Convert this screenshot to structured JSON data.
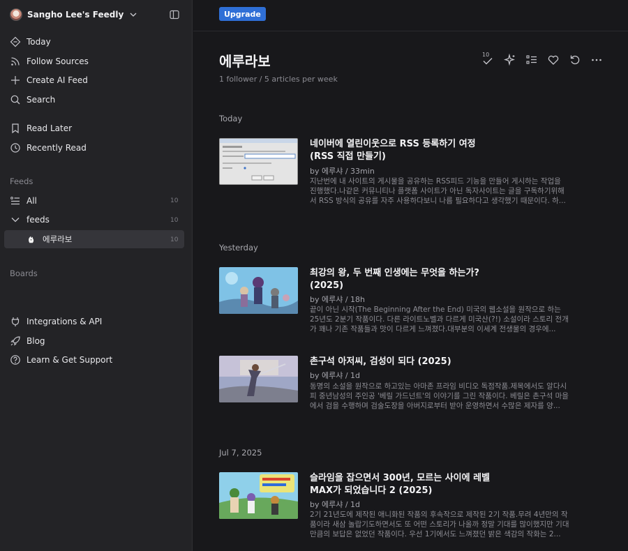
{
  "sidebar": {
    "brand_title": "Sangho Lee's Feedly",
    "nav": [
      {
        "label": "Today",
        "icon": "today-icon"
      },
      {
        "label": "Follow Sources",
        "icon": "rss-icon"
      },
      {
        "label": "Create AI Feed",
        "icon": "plus-icon"
      },
      {
        "label": "Search",
        "icon": "search-icon"
      }
    ],
    "nav2": [
      {
        "label": "Read Later",
        "icon": "bookmark-icon"
      },
      {
        "label": "Recently Read",
        "icon": "history-icon"
      }
    ],
    "feeds_label": "Feeds",
    "feeds": {
      "all_label": "All",
      "all_count": "10",
      "folder_label": "feeds",
      "folder_count": "10",
      "source_label": "에루라보",
      "source_count": "10"
    },
    "boards_label": "Boards",
    "footer": [
      {
        "label": "Integrations & API",
        "icon": "plug-icon"
      },
      {
        "label": "Blog",
        "icon": "rocket-icon"
      },
      {
        "label": "Learn & Get Support",
        "icon": "help-icon"
      }
    ]
  },
  "topbar": {
    "upgrade_label": "Upgrade"
  },
  "main": {
    "title": "에루라보",
    "subtitle": "1 follower / 5 articles per week",
    "toolbar_badge": "10",
    "sections": [
      {
        "date": "Today",
        "articles": [
          {
            "title": "네이버에 열린이웃으로 RSS 등록하기 여정 (RSS 직접 만들기)",
            "meta": "by 에루샤 / 33min",
            "summary": "지난번에 내 사이트의 게시물을 공유하는 RSS피드 기능을 만들어 게시하는 작업을 진행했다.나같은 커뮤니티나 플랫폼 사이트가 아닌 독자사이트는 글을 구독하기위해서 RSS 방식의 공유를 자주 사용하다보니 나름 필요하다고 생각했기 때문이다. 하..."
          }
        ]
      },
      {
        "date": "Yesterday",
        "articles": [
          {
            "title": "최강의 왕, 두 번째 인생에는 무엇을 하는가? (2025)",
            "meta": "by 에루샤 / 18h",
            "summary": "끝이 아닌 시작(The Beginning After the End) 미국의 웹소설을 원작으로 하는 25년도 2분기 작품이다. 다른 라이트노벨과 다르게 미국산(?!) 소설이라 스토리 전개가 꽤나 기존 작품들과 맛이 다르게 느껴졌다.대부분의 이세계 전생물의 경우에..."
          },
          {
            "title": "촌구석 아저씨, 검성이 되다 (2025)",
            "meta": "by 에루샤 / 1d",
            "summary": "동명의 소설을 원작으로 하고있는 아마존 프라임 비디오 독점작품.제목에서도 알다시피 중년남성의 주인공 '베릴 가드넌트'의 이야기를 그린 작품이다. 베릴은 촌구석 마을에서 검을 수행하며 검술도장을 아버지로부터 받아 운영하면서 수많은 제자를 양..."
          }
        ]
      },
      {
        "date": "Jul 7, 2025",
        "articles": [
          {
            "title": "슬라임을 잡으면서 300년, 모르는 사이에 레벨 MAX가 되었습니다 2 (2025)",
            "meta": "by 에루샤 / 1d",
            "summary": "2기 21년도에 제작된 애니화된 작품의 후속작으로 제작된 2기 작품.무려 4년만의 작품이라 새삼 놀랍기도하면서도 또 어떤 스토리가 나올까 정말 기대를 많이했지만 기대만큼의 보답은 없었던 작품이다. 우선 1기에서도 느껴졌던 밝은 색감의 작화는 2..."
          }
        ]
      }
    ]
  }
}
